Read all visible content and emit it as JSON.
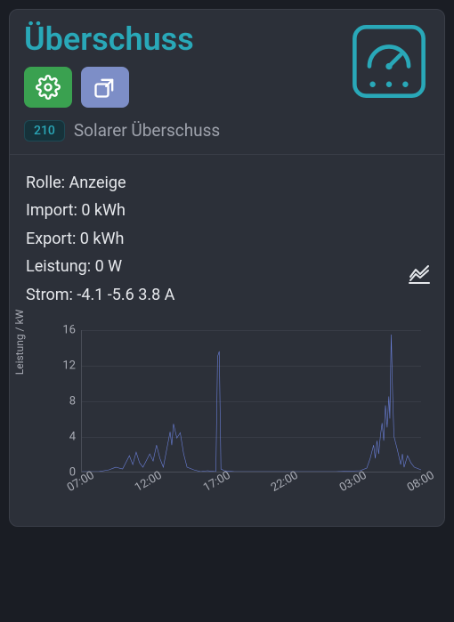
{
  "card": {
    "title": "Überschuss",
    "pill": "210",
    "subtitle": "Solarer Überschuss"
  },
  "stats": {
    "role_label": "Rolle:",
    "role_value": "Anzeige",
    "import_label": "Import:",
    "import_value": "0 kWh",
    "export_label": "Export:",
    "export_value": "0 kWh",
    "power_label": "Leistung:",
    "power_value": "0 W",
    "current_label": "Strom:",
    "current_value": "-4.1 -5.6 3.8 A"
  },
  "chart_data": {
    "type": "line",
    "ylabel": "Leistung / kW",
    "ylim": [
      0,
      16
    ],
    "yticks": [
      0,
      4,
      8,
      12,
      16
    ],
    "x_categories": [
      "07:00",
      "12:00",
      "17:00",
      "22:00",
      "03:00",
      "08:00"
    ],
    "series": [
      {
        "name": "Leistung",
        "color": "#6a7fd8",
        "points": [
          [
            0.0,
            0.0
          ],
          [
            0.05,
            0.0
          ],
          [
            0.08,
            0.2
          ],
          [
            0.1,
            0.5
          ],
          [
            0.12,
            0.3
          ],
          [
            0.14,
            1.8
          ],
          [
            0.15,
            0.8
          ],
          [
            0.16,
            2.2
          ],
          [
            0.17,
            1.0
          ],
          [
            0.18,
            0.5
          ],
          [
            0.2,
            2.0
          ],
          [
            0.21,
            1.2
          ],
          [
            0.22,
            3.0
          ],
          [
            0.23,
            1.5
          ],
          [
            0.24,
            0.5
          ],
          [
            0.26,
            4.5
          ],
          [
            0.265,
            3.0
          ],
          [
            0.27,
            5.4
          ],
          [
            0.28,
            3.8
          ],
          [
            0.29,
            4.4
          ],
          [
            0.3,
            2.0
          ],
          [
            0.31,
            0.5
          ],
          [
            0.33,
            0.2
          ],
          [
            0.35,
            0.0
          ],
          [
            0.37,
            0.1
          ],
          [
            0.395,
            0.0
          ],
          [
            0.4,
            13.0
          ],
          [
            0.405,
            13.6
          ],
          [
            0.41,
            0.3
          ],
          [
            0.42,
            0.1
          ],
          [
            0.45,
            0.0
          ],
          [
            0.55,
            0.0
          ],
          [
            0.65,
            0.0
          ],
          [
            0.75,
            0.0
          ],
          [
            0.82,
            0.1
          ],
          [
            0.84,
            0.4
          ],
          [
            0.85,
            1.5
          ],
          [
            0.86,
            3.0
          ],
          [
            0.865,
            1.5
          ],
          [
            0.87,
            3.5
          ],
          [
            0.875,
            2.0
          ],
          [
            0.88,
            4.0
          ],
          [
            0.885,
            5.5
          ],
          [
            0.89,
            3.5
          ],
          [
            0.895,
            7.5
          ],
          [
            0.9,
            5.0
          ],
          [
            0.905,
            8.5
          ],
          [
            0.908,
            6.0
          ],
          [
            0.912,
            15.5
          ],
          [
            0.916,
            9.0
          ],
          [
            0.92,
            4.0
          ],
          [
            0.93,
            2.5
          ],
          [
            0.94,
            0.8
          ],
          [
            0.945,
            2.0
          ],
          [
            0.95,
            0.5
          ],
          [
            0.96,
            1.8
          ],
          [
            0.97,
            1.0
          ],
          [
            0.98,
            0.5
          ],
          [
            1.0,
            0.2
          ]
        ]
      }
    ]
  }
}
